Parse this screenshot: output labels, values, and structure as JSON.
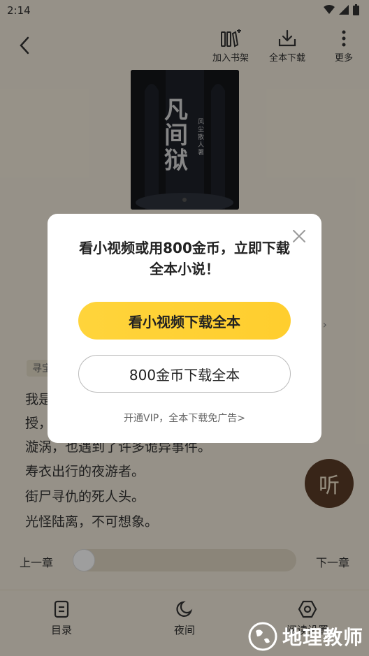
{
  "status": {
    "time": "2:14"
  },
  "toolbar": {
    "add_shelf_label": "加入书架",
    "download_all_label": "全本下载",
    "more_label": "更多"
  },
  "cover": {
    "title": "凡间狱",
    "author": "风尘散人 著"
  },
  "content": {
    "tag": "寻宝",
    "paragraphs": [
      "我是...教",
      "授，...大的",
      "漩涡，也遇到了许多诡异事件。",
      "寿衣出行的夜游者。",
      "街尸寻仇的死人头。",
      "光怪陆离，不可想象。"
    ]
  },
  "listen": {
    "label": "听"
  },
  "chapter": {
    "prev_label": "上一章",
    "next_label": "下一章",
    "progress": 0
  },
  "bottom_nav": {
    "toc_label": "目录",
    "night_label": "夜间",
    "settings_label": "阅读设置"
  },
  "dialog": {
    "title": "看小视频或用800金币，立即下载全本小说！",
    "primary_btn": "看小视频下载全本",
    "secondary_btn": "800金币下载全本",
    "vip_link": "开通VIP，全本下载免广告>"
  },
  "watermark": {
    "text": "地理教师"
  },
  "colors": {
    "accent": "#ffd43b",
    "background": "#f3ebdb",
    "listen_btn": "#5b3c28"
  }
}
